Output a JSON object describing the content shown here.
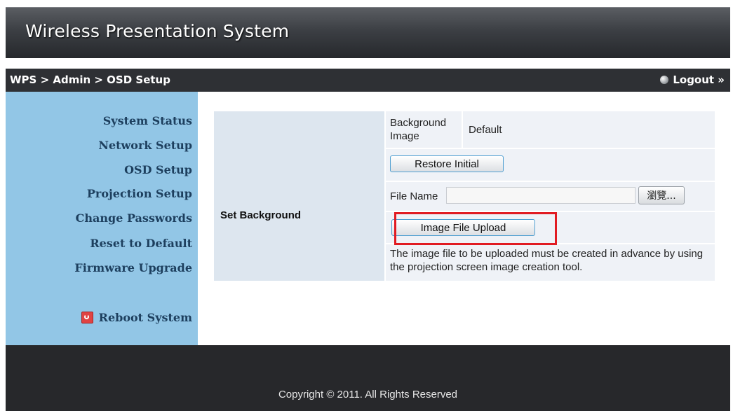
{
  "header": {
    "title": "Wireless Presentation System"
  },
  "navbar": {
    "breadcrumb": "WPS > Admin > OSD Setup",
    "logout_label": "Logout »"
  },
  "sidebar": {
    "items": [
      {
        "label": "System Status"
      },
      {
        "label": "Network Setup"
      },
      {
        "label": "OSD Setup"
      },
      {
        "label": "Projection Setup"
      },
      {
        "label": "Change Passwords"
      },
      {
        "label": "Reset to Default"
      },
      {
        "label": "Firmware Upgrade"
      }
    ],
    "reboot_label": "Reboot System",
    "reboot_icon": "power-icon"
  },
  "form": {
    "section_label": "Set Background",
    "background_image_label": "Background\nImage",
    "background_image_value": "Default",
    "restore_button": "Restore Initial",
    "file_name_label": "File Name",
    "file_name_value": "",
    "browse_button": "瀏覽...",
    "upload_button": "Image File Upload",
    "note": "The image file to be uploaded must be created in advance by using the projection screen image creation tool."
  },
  "colors": {
    "highlight": "#e11b22",
    "sidebar_bg": "#92c6e6",
    "header_bg": "#3c3f44"
  },
  "footer": {
    "copyright": "Copyright © 2011. All Rights Reserved"
  }
}
